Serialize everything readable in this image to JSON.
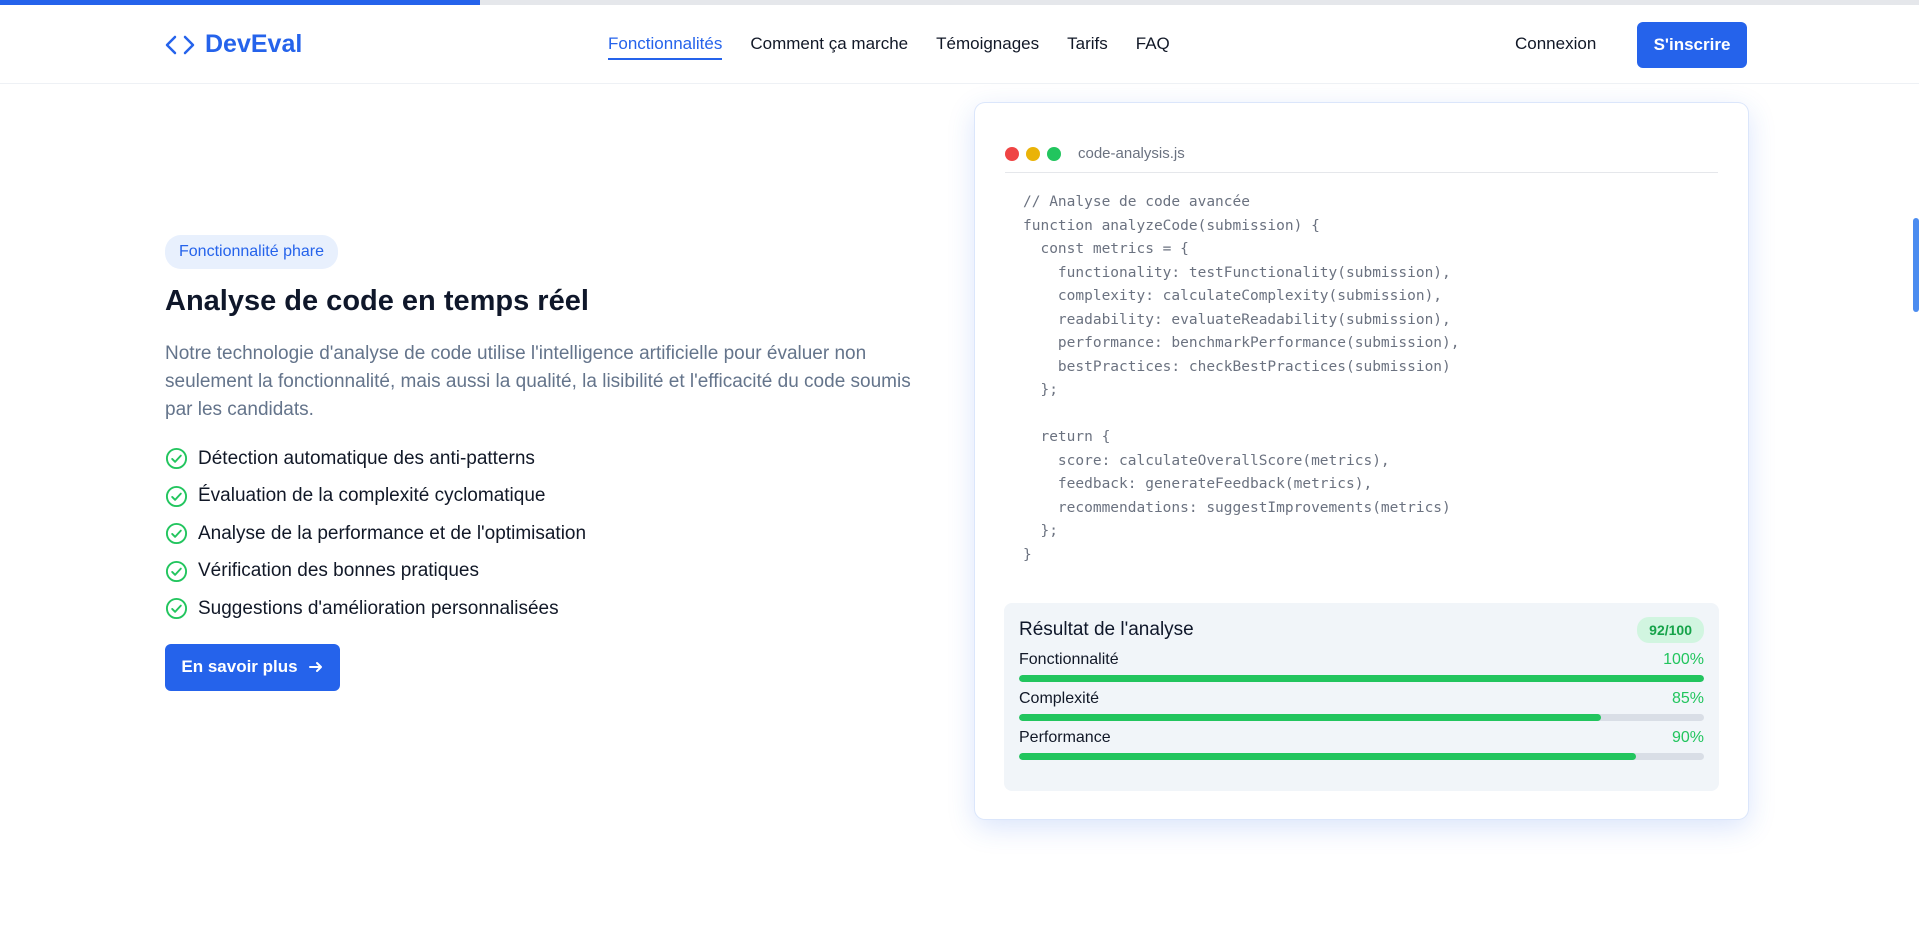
{
  "brand": {
    "name": "DevEval",
    "color": "#2563eb"
  },
  "nav": [
    {
      "label": "Fonctionnalités",
      "active": true
    },
    {
      "label": "Comment ça marche",
      "active": false
    },
    {
      "label": "Témoignages",
      "active": false
    },
    {
      "label": "Tarifs",
      "active": false
    },
    {
      "label": "FAQ",
      "active": false
    }
  ],
  "auth": {
    "login": "Connexion",
    "signup": "S'inscrire"
  },
  "hero": {
    "badge": "Fonctionnalité phare",
    "title": "Analyse de code en temps réel",
    "description": "Notre technologie d'analyse de code utilise l'intelligence artificielle pour évaluer non seulement la fonctionnalité, mais aussi la qualité, la lisibilité et l'efficacité du code soumis par les candidats.",
    "features": [
      "Détection automatique des anti-patterns",
      "Évaluation de la complexité cyclomatique",
      "Analyse de la performance et de l'optimisation",
      "Vérification des bonnes pratiques",
      "Suggestions d'amélioration personnalisées"
    ],
    "cta": "En savoir plus"
  },
  "code_window": {
    "filename": "code-analysis.js",
    "dots": [
      "#ef4444",
      "#eab308",
      "#22c55e"
    ],
    "code": "// Analyse de code avancée\nfunction analyzeCode(submission) {\n  const metrics = {\n    functionality: testFunctionality(submission),\n    complexity: calculateComplexity(submission),\n    readability: evaluateReadability(submission),\n    performance: benchmarkPerformance(submission),\n    bestPractices: checkBestPractices(submission)\n  };\n\n  return {\n    score: calculateOverallScore(metrics),\n    feedback: generateFeedback(metrics),\n    recommendations: suggestImprovements(metrics)\n  };\n}"
  },
  "result": {
    "title": "Résultat de l'analyse",
    "score": "92/100",
    "metrics": [
      {
        "label": "Fonctionnalité",
        "percent": "100%",
        "value": 100
      },
      {
        "label": "Complexité",
        "percent": "85%",
        "value": 85
      },
      {
        "label": "Performance",
        "percent": "90%",
        "value": 90
      }
    ]
  },
  "colors": {
    "accent": "#2563eb",
    "success": "#22c55e",
    "muted": "#64748b"
  }
}
